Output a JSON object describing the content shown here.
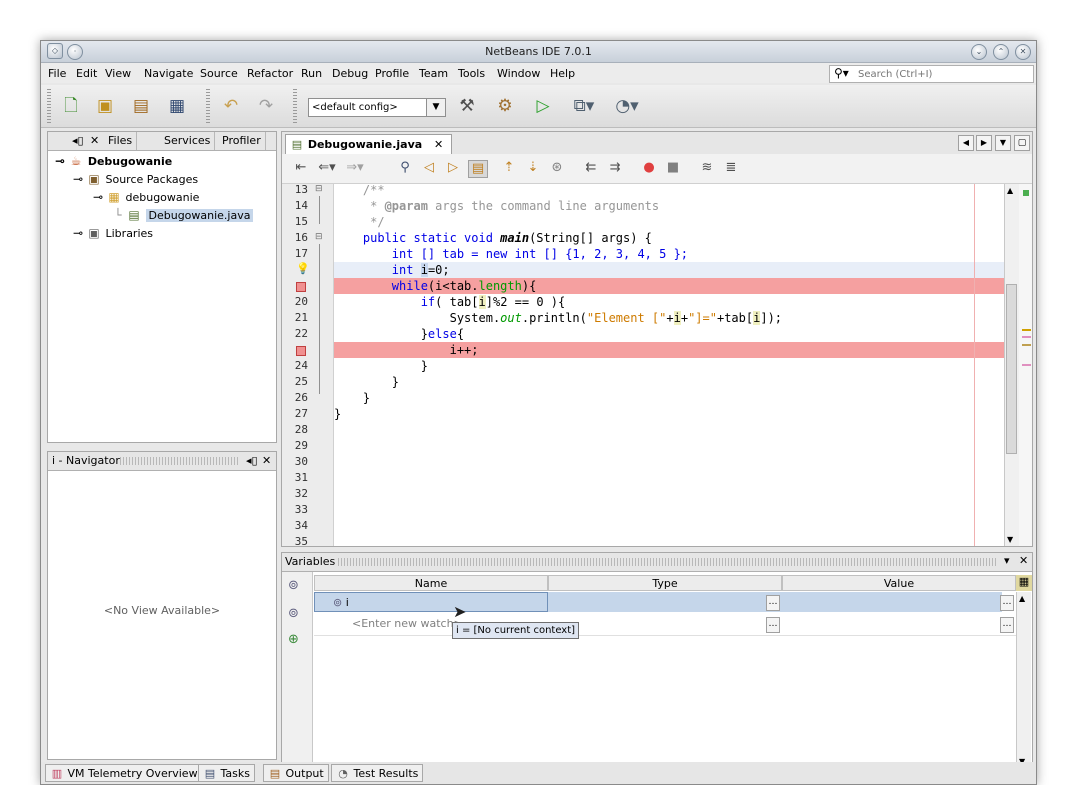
{
  "window": {
    "title": "NetBeans IDE 7.0.1"
  },
  "menu": [
    "File",
    "Edit",
    "View",
    "Navigate",
    "Source",
    "Refactor",
    "Run",
    "Debug",
    "Profile",
    "Team",
    "Tools",
    "Window",
    "Help"
  ],
  "search": {
    "placeholder": "Search (Ctrl+I)"
  },
  "toolbar": {
    "config": "<default config>"
  },
  "projects": {
    "tabs": [
      "Files",
      "Services",
      "Profiler"
    ],
    "tree": {
      "project": "Debugowanie",
      "source_packages": "Source Packages",
      "package": "debugowanie",
      "file": "Debugowanie.java",
      "libraries": "Libraries"
    }
  },
  "navigator": {
    "title": "i - Navigator",
    "empty": "<No View Available>"
  },
  "editor": {
    "tab": "Debugowanie.java",
    "line_numbers": [
      "13",
      "14",
      "15",
      "16",
      "17",
      "",
      "",
      "20",
      "21",
      "22",
      "",
      "24",
      "25",
      "26",
      "27",
      "28",
      "29",
      "30",
      "31",
      "32",
      "33",
      "34",
      "35"
    ],
    "code": {
      "l13": "    /**",
      "l14_a": "     * ",
      "l14_tag": "@param",
      "l14_b": " args the command line arguments",
      "l15": "     */",
      "l16_a": "    public static void ",
      "l16_m": "main",
      "l16_b": "(String[] args) {",
      "l17_a": "        int [] tab = ",
      "l17_new": "new",
      "l17_b": " int [] {1, 2, 3, 4, 5 };",
      "l18_kw": "        int ",
      "l18_v": "i",
      "l18_b": "=0;",
      "l19_kw": "        while",
      "l19_a": "(i<tab.",
      "l19_f": "length",
      "l19_b": "){",
      "l20_kw": "            if",
      "l20_a": "( tab[",
      "l20_v": "i",
      "l20_b": "]%2 == 0 ){",
      "l21_a": "                System.",
      "l21_out": "out",
      "l21_b": ".println(",
      "l21_s1": "\"Element [\"",
      "l21_c": "+",
      "l21_v": "i",
      "l21_d": "+",
      "l21_s2": "\"]=\"",
      "l21_e": "+tab[",
      "l21_v2": "i",
      "l21_f": "]);",
      "l22_a": "            }",
      "l22_kw": "else",
      "l22_b": "{",
      "l23": "                i++;",
      "l24": "            }",
      "l25": "        }",
      "l26": "    }",
      "l27": "}"
    }
  },
  "variables": {
    "title": "Variables",
    "columns": [
      "Name",
      "Type",
      "Value"
    ],
    "rows": [
      {
        "name": "i",
        "type": "",
        "value": ""
      }
    ],
    "new_watch": "<Enter new watch>",
    "tooltip": "i = [No current context]"
  },
  "status": [
    "VM Telemetry Overview",
    "Tasks",
    "Output",
    "Test Results"
  ]
}
